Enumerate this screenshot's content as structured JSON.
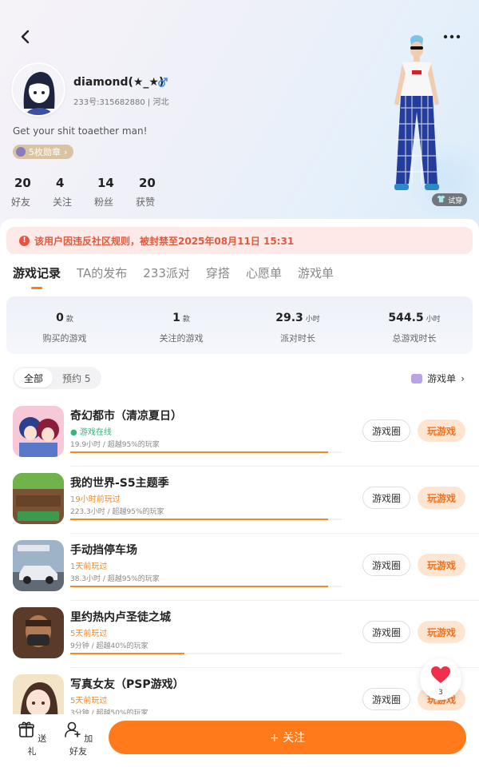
{
  "profile": {
    "nickname": "diamond(★_★)",
    "uid_region": "233号:315682880 | 河北",
    "bio": "Get your shit toaether man!",
    "medal_label": "5枚勋章",
    "try_on": "试穿",
    "stats": [
      {
        "value": "20",
        "label": "好友"
      },
      {
        "value": "4",
        "label": "关注"
      },
      {
        "value": "14",
        "label": "粉丝"
      },
      {
        "value": "20",
        "label": "获赞"
      }
    ]
  },
  "ban_notice": "该用户因违反社区规则，被封禁至2025年08月11日 15:31",
  "tabs": [
    "游戏记录",
    "TA的发布",
    "233派对",
    "穿搭",
    "心愿单",
    "游戏单"
  ],
  "summary": [
    {
      "value": "0",
      "unit": "款",
      "label": "购买的游戏"
    },
    {
      "value": "1",
      "unit": "款",
      "label": "关注的游戏"
    },
    {
      "value": "29.3",
      "unit": "小时",
      "label": "派对时长"
    },
    {
      "value": "544.5",
      "unit": "小时",
      "label": "总游戏时长"
    }
  ],
  "filters": {
    "all": "全部",
    "reserved": "预约 5",
    "game_list": "游戏单"
  },
  "games": [
    {
      "title": "奇幻都市（清凉夏日）",
      "status": "游戏在线",
      "meta": "19.9小时 / 超越95%的玩家",
      "progress": 0.95
    },
    {
      "title": "我的世界-S5主题季",
      "status": "19小时前玩过",
      "meta": "223.3小时 / 超越95%的玩家",
      "progress": 0.95
    },
    {
      "title": "手动挡停车场",
      "status": "1天前玩过",
      "meta": "38.3小时 / 超越95%的玩家",
      "progress": 0.95
    },
    {
      "title": "里约热内卢圣徒之城",
      "status": "5天前玩过",
      "meta": "9分钟 / 超越40%的玩家",
      "progress": 0.42
    },
    {
      "title": "写真女友（PSP游戏）",
      "status": "5天前玩过",
      "meta": "3分钟 / 超越50%的玩家",
      "progress": 0.5
    }
  ],
  "buttons": {
    "circle": "游戏圈",
    "play": "玩游戏"
  },
  "like_count": "3",
  "bottom": {
    "gift": "送礼",
    "add_friend": "加好友",
    "follow": "+ 关注"
  },
  "colors": {
    "accent": "#ff7a1a",
    "ban_text": "#e05a3e",
    "online": "#2fb67a"
  }
}
